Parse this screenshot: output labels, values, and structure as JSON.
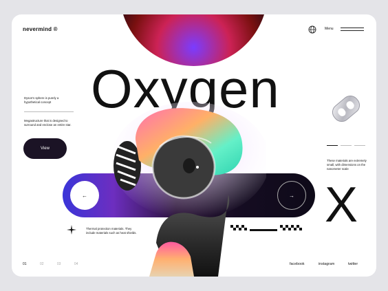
{
  "brand": {
    "logo": "nevermind ®"
  },
  "header": {
    "menu_label": "Menu"
  },
  "hero": {
    "title": "Oxygen"
  },
  "left": {
    "text1": "Dyson's sphere is purely a hypothetical concept",
    "text2": "Megastructure that is designed to surround and enclose an entire star.",
    "view_button": "View"
  },
  "slider": {
    "prev_arrow": "←",
    "next_arrow": "→",
    "big_letter": "X"
  },
  "captions": {
    "bottom": "Thermal protection materials. They include materials such as heat shields.",
    "right": "These materials are extremely small, with dimensions on the nanometer scale"
  },
  "pagination": [
    "01",
    "02",
    "03",
    "04"
  ],
  "social": [
    "facebook",
    "instagram",
    "twitter"
  ],
  "colors": {
    "background": "#e4e4e8",
    "card": "#ffffff",
    "button": "#1b1325",
    "accent_purple": "#6d2ec0",
    "accent_blue": "#3a35d8"
  }
}
